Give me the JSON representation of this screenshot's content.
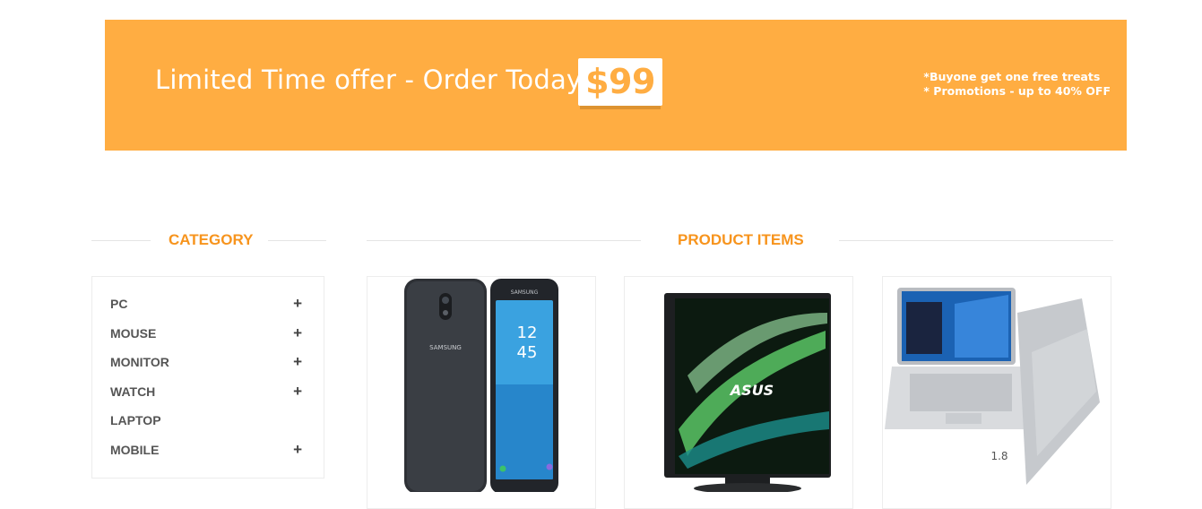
{
  "banner": {
    "headline": "Limited Time offer - Order Today For",
    "price": "$99",
    "promo_line_1": "*Buyone get one free treats",
    "promo_line_2": "* Promotions - up to 40% OFF",
    "background_color": "#ffad42"
  },
  "category": {
    "heading": "CATEGORY",
    "items": [
      {
        "label": "PC",
        "expandable": true,
        "icon": "plus-icon"
      },
      {
        "label": "MOUSE",
        "expandable": true,
        "icon": "plus-icon"
      },
      {
        "label": "MONITOR",
        "expandable": true,
        "icon": "plus-icon"
      },
      {
        "label": "WATCH",
        "expandable": true,
        "icon": "plus-icon"
      },
      {
        "label": "LAPTOP",
        "expandable": false
      },
      {
        "label": "MOBILE",
        "expandable": true,
        "icon": "plus-icon"
      }
    ],
    "plus_symbol": "+"
  },
  "products": {
    "heading": "PRODUCT ITEMS",
    "items": [
      {
        "image": "samsung-phone-image",
        "brand_text": "SAMSUNG",
        "screen_time_hour": "12",
        "screen_time_min": "45"
      },
      {
        "image": "asus-monitor-image",
        "brand_text": "ASUS"
      },
      {
        "image": "samsung-laptop-image",
        "spec_text": "1.8"
      }
    ]
  },
  "colors": {
    "accent": "#f7941d",
    "banner": "#ffad42"
  }
}
